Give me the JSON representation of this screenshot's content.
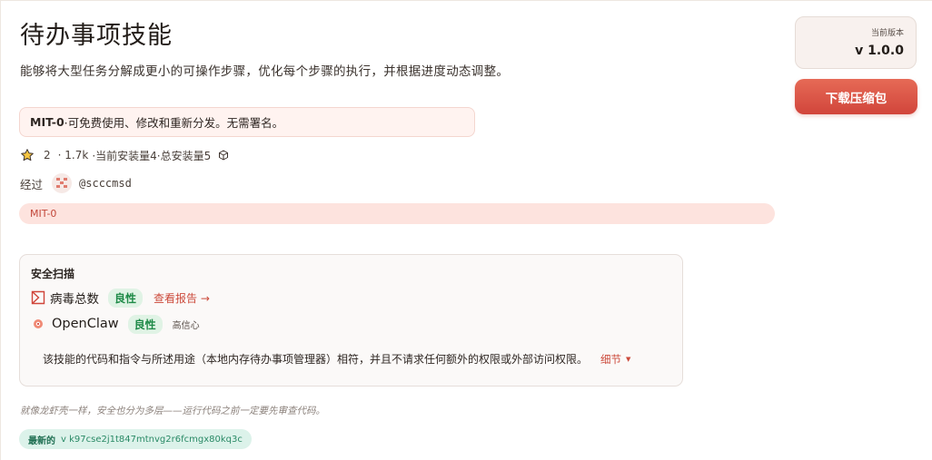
{
  "skill": {
    "title": "待办事项技能",
    "description": "能够将大型任务分解成更小的可操作步骤，优化每个步骤的执行，并根据进度动态调整。"
  },
  "license": {
    "name": "MIT-0",
    "text": " ·可免费使用、修改和重新分发。无需署名。",
    "tag": "MIT-0"
  },
  "stats": {
    "stars": "2",
    "downloads": "· 1.7k",
    "current_installs": "·当前安装量4",
    "total_installs": "·总安装量5"
  },
  "author": {
    "label": "经过",
    "handle": "@scccmsd"
  },
  "security_scan": {
    "title": "安全扫描",
    "engines": [
      {
        "name": "病毒总数",
        "verdict": "良性",
        "link": "查看报告 →",
        "icon": "virustotal-icon"
      },
      {
        "name": "OpenClaw",
        "verdict": "良性",
        "confidence": "高信心",
        "icon": "openclaw-icon"
      }
    ],
    "summary": "该技能的代码和指令与所述用途（本地内存待办事项管理器）相符，并且不请求任何额外的权限或外部访问权限。",
    "details_label": "细节"
  },
  "footnote": "就像龙虾壳一样，安全也分为多层——运行代码之前一定要先审查代码。",
  "latest": {
    "label": "最新的",
    "hash": "v k97cse2j1t847mtnvg2r6fcmgx80kq3c"
  },
  "version": {
    "label": "当前版本",
    "value": "v 1.0.0"
  },
  "download_button": "下载压缩包",
  "colors": {
    "accent": "#d9503f",
    "benign_bg": "#e0f3e5",
    "benign_text": "#1e8a47",
    "license_bg": "#fff3f0",
    "tag_bg": "#fde3de",
    "latest_bg": "#dcf2ea"
  }
}
